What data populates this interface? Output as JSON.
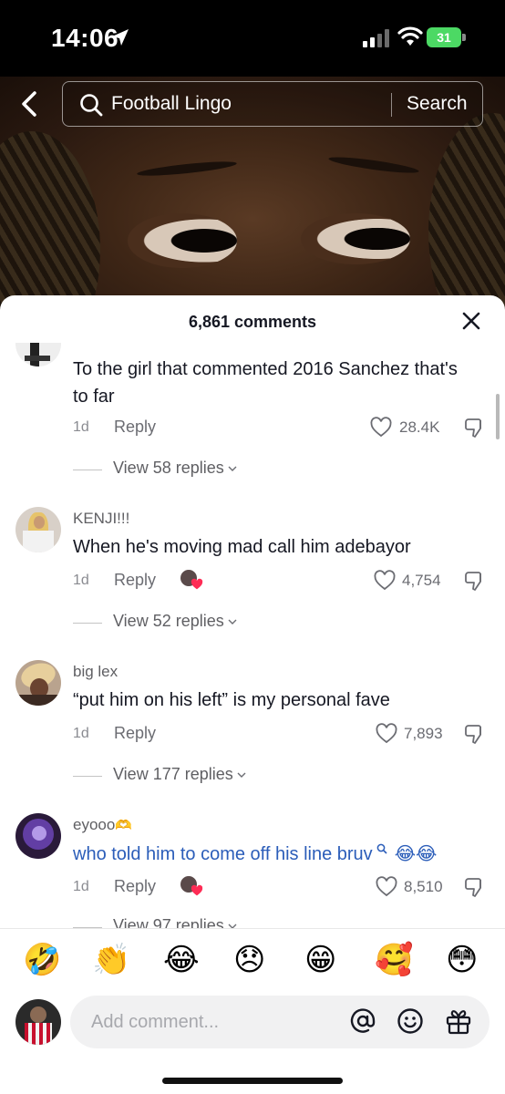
{
  "status_bar": {
    "time": "14:06",
    "battery": "31"
  },
  "search": {
    "query": "Football Lingo",
    "button_label": "Search"
  },
  "sheet": {
    "title": "6,861 comments"
  },
  "comments": [
    {
      "username": "",
      "text": "To the girl that commented 2016 Sanchez that's to far",
      "time": "1d",
      "reply_label": "Reply",
      "likes": "28.4K",
      "view_replies": "View 58 replies",
      "creator_liked": false
    },
    {
      "username": "KENJI!!!",
      "text": "When he's moving mad call him adebayor",
      "time": "1d",
      "reply_label": "Reply",
      "likes": "4,754",
      "view_replies": "View 52 replies",
      "creator_liked": true
    },
    {
      "username": "big lex",
      "text": "“put him on his left” is my personal fave",
      "time": "1d",
      "reply_label": "Reply",
      "likes": "7,893",
      "view_replies": "View 177 replies",
      "creator_liked": false
    },
    {
      "username": "eyooo",
      "username_emoji": "🫶",
      "text": "who told him to come off his line bruv",
      "text_emoji": "😂😂",
      "time": "1d",
      "reply_label": "Reply",
      "likes": "8,510",
      "view_replies": "View 97 replies",
      "creator_liked": true
    }
  ],
  "emoji_bar": [
    "🤣",
    "👏",
    "😂",
    "😞",
    "😁",
    "🥰",
    "😳"
  ],
  "input": {
    "placeholder": "Add comment..."
  },
  "colors": {
    "link": "#2b5db9",
    "battery": "#4cd964",
    "text": "#161823",
    "muted": "#8a8b91"
  },
  "icons": [
    "location-arrow-icon",
    "signal-icon",
    "wifi-icon",
    "battery-icon",
    "back-chevron-icon",
    "search-icon",
    "close-icon",
    "heart-icon",
    "dislike-icon",
    "chevron-down-icon",
    "at-icon",
    "emoji-icon",
    "gift-icon"
  ]
}
